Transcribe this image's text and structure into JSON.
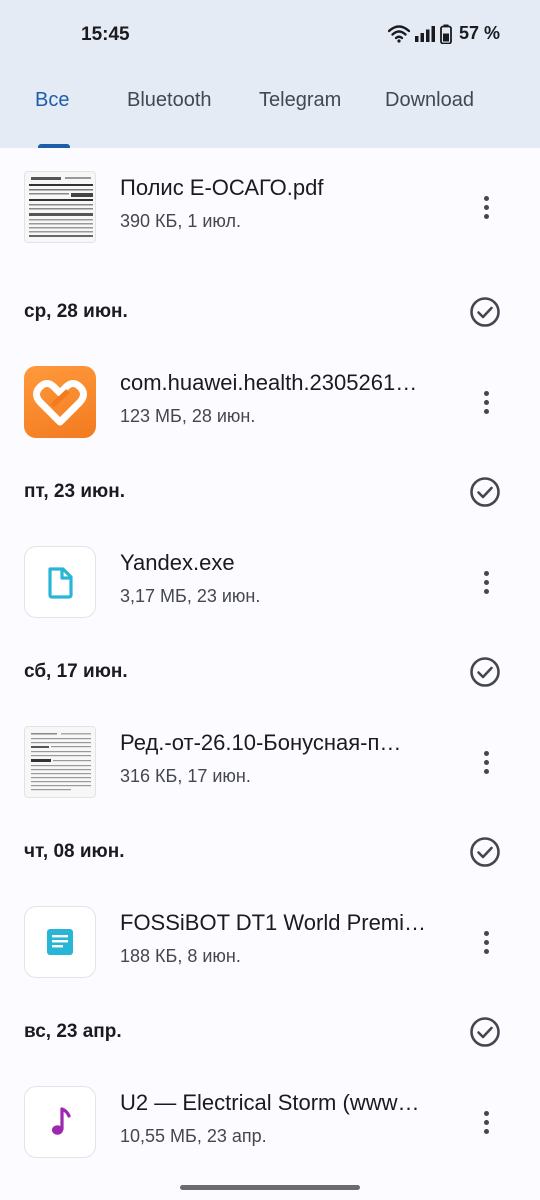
{
  "status_bar": {
    "time": "15:45",
    "battery_percent": "57 %"
  },
  "tabs": [
    {
      "label": "Все",
      "active": true
    },
    {
      "label": "Bluetooth",
      "active": false
    },
    {
      "label": "Telegram",
      "active": false
    },
    {
      "label": "Download",
      "active": false
    }
  ],
  "files": [
    {
      "name": "Полис Е-ОСАГО.pdf",
      "meta": "390 КБ, 1 июл.",
      "thumb": "pdf-preview"
    },
    {
      "name": "com.huawei.health.2305261…",
      "meta": "123 МБ, 28 июн.",
      "thumb": "huawei-health-app-icon"
    },
    {
      "name": "Yandex.exe",
      "meta": "3,17 МБ, 23 июн.",
      "thumb": "file-icon"
    },
    {
      "name": "Ред.-от-26.10-Бонусная-п…",
      "meta": "316 КБ, 17 июн.",
      "thumb": "document-preview"
    },
    {
      "name": "FOSSiBOT DT1 World Premi…",
      "meta": "188 КБ, 8 июн.",
      "thumb": "text-document-icon"
    },
    {
      "name": "U2 — Electrical Storm (www…",
      "meta": "10,55 МБ, 23 апр.",
      "thumb": "music-note-icon"
    }
  ],
  "date_groups": [
    {
      "label": "ср, 28 июн."
    },
    {
      "label": "пт, 23 июн."
    },
    {
      "label": "сб, 17 июн."
    },
    {
      "label": "чт, 08 июн."
    },
    {
      "label": "вс, 23 апр."
    }
  ],
  "colors": {
    "accent": "#1d5ea8",
    "header_bg": "#e4ebf5",
    "file_icon": "#29b6d6",
    "music_icon": "#9c27b0",
    "app_orange": "#f37a1f"
  }
}
